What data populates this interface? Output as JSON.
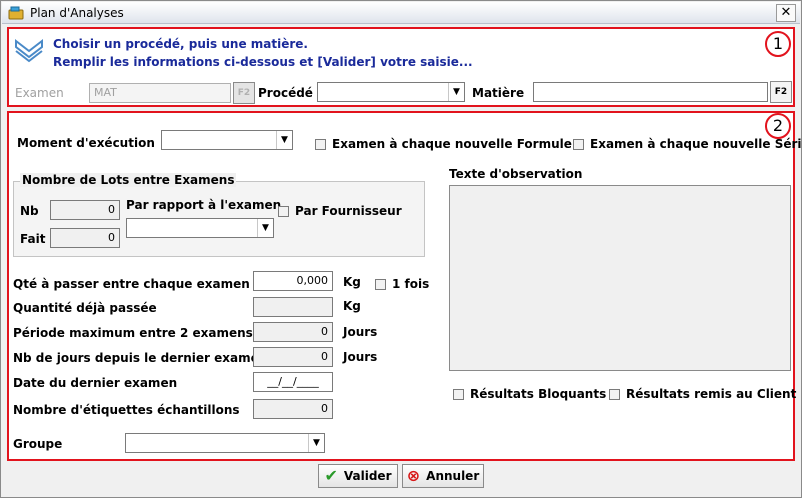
{
  "window": {
    "title": "Plan d'Analyses",
    "close_label": "✕"
  },
  "section1": {
    "badge": "1",
    "instruction_line1": "Choisir un procédé, puis une matière.",
    "instruction_line2": "Remplir les informations ci-dessous et [Valider] votre saisie...",
    "examen_label": "Examen",
    "examen_value": "MAT",
    "f2_label": "F2",
    "procede_label": "Procédé",
    "procede_value": "",
    "matiere_label": "Matière",
    "matiere_value": ""
  },
  "section2": {
    "badge": "2",
    "moment_label": "Moment d'exécution",
    "moment_value": "",
    "chk_formule": "Examen à chaque nouvelle Formule",
    "chk_serie": "Examen à chaque nouvelle Série",
    "lots_group": "Nombre de Lots entre Examens",
    "nb_label": "Nb",
    "nb_value": "0",
    "fait_label": "Fait",
    "fait_value": "0",
    "par_rapport_label": "Par rapport à l'examen",
    "par_rapport_value": "",
    "chk_fournisseur": "Par Fournisseur",
    "texte_obs_label": "Texte d'observation",
    "qte_label": "Qté à passer entre chaque examen",
    "qte_value": "0,000",
    "qte_unit": "Kg",
    "chk_1fois": "1 fois",
    "qte_passee_label": "Quantité déjà passée",
    "qte_passee_value": "",
    "qte_passee_unit": "Kg",
    "periode_label": "Période maximum entre 2 examens",
    "periode_value": "0",
    "periode_unit": "Jours",
    "nbjours_label": "Nb de jours depuis le dernier examen",
    "nbjours_value": "0",
    "nbjours_unit": "Jours",
    "date_label": "Date du dernier examen",
    "date_value": "__/__/____",
    "etiquettes_label": "Nombre d'étiquettes échantillons",
    "etiquettes_value": "0",
    "chk_bloquants": "Résultats Bloquants",
    "chk_client": "Résultats remis au Client",
    "groupe_label": "Groupe",
    "groupe_value": ""
  },
  "buttons": {
    "valider": "Valider",
    "annuler": "Annuler"
  },
  "colors": {
    "accent_red": "#e2131d",
    "instruction_blue": "#1a2a9a"
  }
}
